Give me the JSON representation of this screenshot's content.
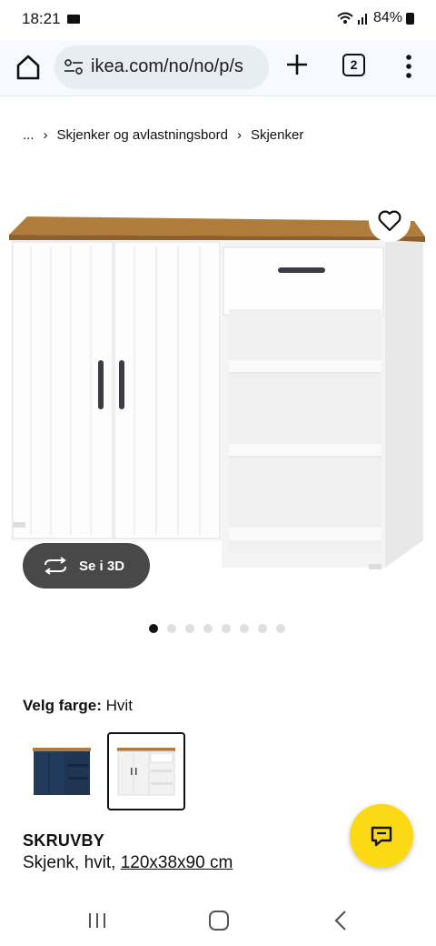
{
  "status_bar": {
    "time": "18:21",
    "battery": "84%"
  },
  "browser": {
    "url": "ikea.com/no/no/p/s",
    "tab_count": "2"
  },
  "breadcrumb": {
    "ellipsis": "...",
    "items": [
      "Skjenker og avlastningsbord",
      "Skjenker"
    ]
  },
  "gallery": {
    "view_3d_label": "Se i 3D",
    "dot_count": 8,
    "active_dot": 0
  },
  "color": {
    "label": "Velg farge:",
    "value": "Hvit"
  },
  "product": {
    "name": "SKRUVBY",
    "description": "Skjenk, hvit,",
    "size": "120x38x90 cm"
  },
  "colors": {
    "accent": "#fbd914",
    "wood": "#b07c3c",
    "dark_variant": "#1f3552"
  }
}
